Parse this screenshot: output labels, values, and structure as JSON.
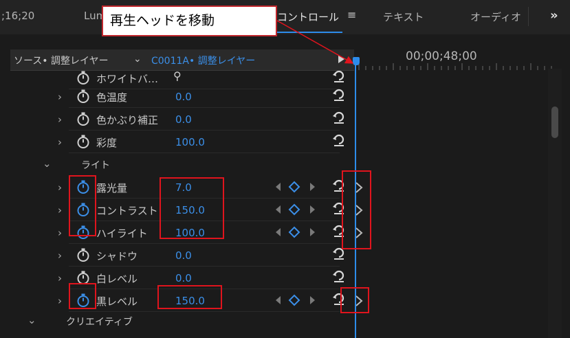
{
  "tabs": {
    "timecode_left": ";16;20",
    "lumetri": "Lum",
    "control": "コントロール",
    "menu_icon": "≡",
    "text": "テキスト",
    "audio": "オーディオ",
    "more_icon": "»"
  },
  "callout": "再生ヘッドを移動",
  "source": {
    "label": "ソース• 調整レイヤー",
    "chevron": "⌄",
    "clip": "C0011A• 調整レイヤー"
  },
  "timeline": {
    "timecode": "00;00;48;00"
  },
  "rows": [
    {
      "name": "ホワイトバ…",
      "value": "",
      "tool": "eyedropper-icon"
    },
    {
      "name": "色温度",
      "value": "0.0"
    },
    {
      "name": "色かぶり補正",
      "value": "0.0"
    },
    {
      "name": "彩度",
      "value": "100.0"
    },
    {
      "name": "ライト",
      "value": ""
    },
    {
      "name": "露光量",
      "value": "7.0",
      "keyframed": true
    },
    {
      "name": "コントラスト",
      "value": "150.0",
      "keyframed": true
    },
    {
      "name": "ハイライト",
      "value": "100.0",
      "keyframed": true
    },
    {
      "name": "シャドウ",
      "value": "0.0"
    },
    {
      "name": "白レベル",
      "value": "0.0"
    },
    {
      "name": "黒レベル",
      "value": "150.0",
      "keyframed": true
    },
    {
      "name": "クリエイティブ",
      "value": ""
    }
  ],
  "colors": {
    "accent_blue": "#3b8fe8",
    "highlight_red": "#e0141d",
    "panel_bg": "#1b1b1b"
  }
}
